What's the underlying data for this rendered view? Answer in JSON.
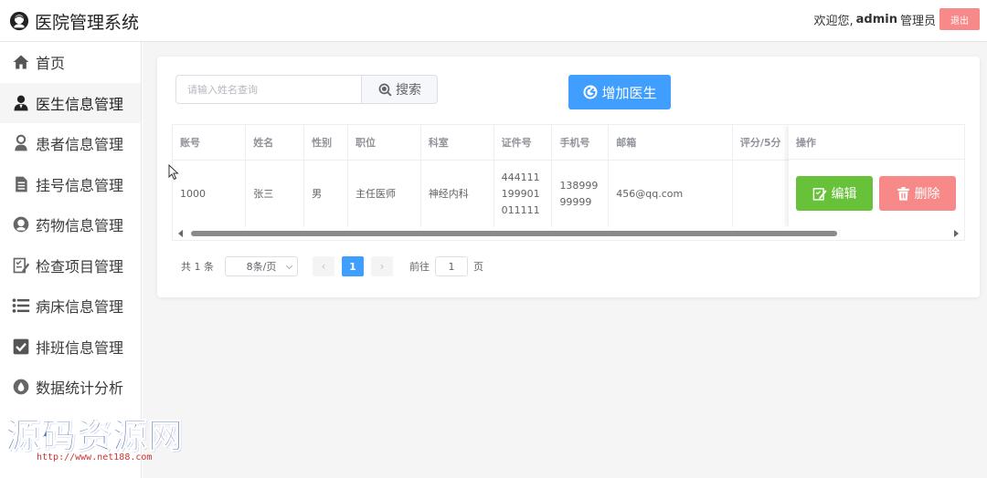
{
  "header": {
    "app_title": "医院管理系统",
    "welcome": "欢迎您,",
    "username": "admin",
    "role": "管理员",
    "logout_label": "退出",
    "logo_icon": "doctor-avatar-icon"
  },
  "sidebar": {
    "items": [
      {
        "label": "首页",
        "icon": "home-icon"
      },
      {
        "label": "医生信息管理",
        "icon": "doctor-icon",
        "active": true
      },
      {
        "label": "患者信息管理",
        "icon": "patient-icon"
      },
      {
        "label": "挂号信息管理",
        "icon": "document-icon"
      },
      {
        "label": "药物信息管理",
        "icon": "medicine-icon"
      },
      {
        "label": "检查项目管理",
        "icon": "checklist-edit-icon"
      },
      {
        "label": "病床信息管理",
        "icon": "list-icon"
      },
      {
        "label": "排班信息管理",
        "icon": "checkbox-icon"
      },
      {
        "label": "数据统计分析",
        "icon": "drop-icon"
      }
    ]
  },
  "toolbar": {
    "search_placeholder": "请输入姓名查询",
    "search_value": "",
    "search_label": "搜索",
    "add_label": "增加医生"
  },
  "table": {
    "columns": [
      "账号",
      "姓名",
      "性别",
      "职位",
      "科室",
      "证件号",
      "手机号",
      "邮箱",
      "评分/5分"
    ],
    "action_header": "操作",
    "rows": [
      [
        "1000",
        "张三",
        "男",
        "主任医师",
        "神经内科",
        "444111199901011111",
        "13899999999",
        "456@qq.com",
        ""
      ]
    ],
    "edit_label": "编辑",
    "delete_label": "删除"
  },
  "pagination": {
    "total": "共 1 条",
    "page_size": "8条/页",
    "current_page": "1",
    "goto_prefix": "前往",
    "goto_value": "1",
    "goto_suffix": "页"
  },
  "watermark": {
    "title": "源码资源网",
    "url": "http://www.net188.com"
  },
  "colors": {
    "primary": "#409eff",
    "success": "#67c23a",
    "danger": "#f78989"
  }
}
